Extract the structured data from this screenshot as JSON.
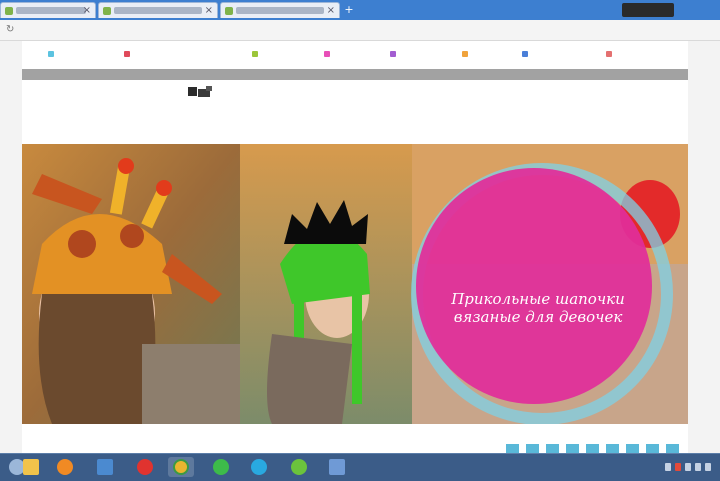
{
  "browser": {
    "tabs": [
      {
        "label": ""
      },
      {
        "label": ""
      },
      {
        "label": ""
      }
    ],
    "new_tab_label": "+",
    "address": {
      "url": ""
    }
  },
  "site": {
    "nav": [
      {
        "label": "",
        "color": "#5cc3e0"
      },
      {
        "label": "",
        "color": "#e04a5b"
      },
      {
        "label": "",
        "color": "#9cc63a"
      },
      {
        "label": "",
        "color": "#e84fb8"
      },
      {
        "label": "",
        "color": "#a35dd1"
      },
      {
        "label": "",
        "color": "#f0a33c"
      },
      {
        "label": "",
        "color": "#4a7fd8"
      },
      {
        "label": "",
        "color": "#e47070"
      }
    ],
    "logo_text": "",
    "dateline": "",
    "banner": {
      "headline_line1": "Прикольные шапочки",
      "headline_line2": "вязаные для девочек",
      "circle_color": "#e12d9a"
    },
    "slider_thumbs": 9
  },
  "taskbar": {
    "apps": [
      {
        "name": "start-orb",
        "color": "#9bb7d9"
      },
      {
        "name": "explorer",
        "color": "#f1c34b"
      },
      {
        "name": "media-player",
        "color": "#f08a24"
      },
      {
        "name": "file-manager",
        "color": "#4b8ad0"
      },
      {
        "name": "opera",
        "color": "#e0332f"
      },
      {
        "name": "chrome",
        "color": "#e9b52f"
      },
      {
        "name": "whatsapp",
        "color": "#3dbb4a"
      },
      {
        "name": "skype",
        "color": "#29a9e0"
      },
      {
        "name": "icq",
        "color": "#6bc33c"
      },
      {
        "name": "window",
        "color": "#6f9ad6"
      }
    ]
  }
}
